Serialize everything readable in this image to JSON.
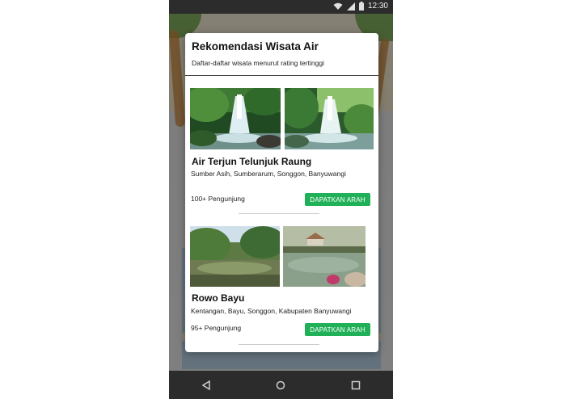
{
  "status_bar": {
    "time": "12:30"
  },
  "dialog": {
    "title": "Rekomendasi Wisata Air",
    "subtitle": "Daftar-daftar wisata menurut rating tertinggi"
  },
  "places": [
    {
      "name": "Air Terjun Telunjuk Raung",
      "address": "Sumber Asih, Sumberarum, Songgon, Banyuwangi",
      "visitors": "100+ Pengunjung",
      "button_label": "DAPATKAN ARAH"
    },
    {
      "name": "Rowo Bayu",
      "address": "Kentangan, Bayu, Songgon, Kabupaten Banyuwangi",
      "visitors": "95+ Pengunjung",
      "button_label": "DAPATKAN ARAH"
    }
  ],
  "colors": {
    "button": "#20b057",
    "status_bar": "#2c2c2c",
    "nav_bar": "#2c2c2c"
  },
  "icons": {
    "status": [
      "wifi-icon",
      "signal-icon",
      "battery-icon"
    ],
    "nav": [
      "back-icon",
      "home-icon",
      "recents-icon"
    ]
  }
}
